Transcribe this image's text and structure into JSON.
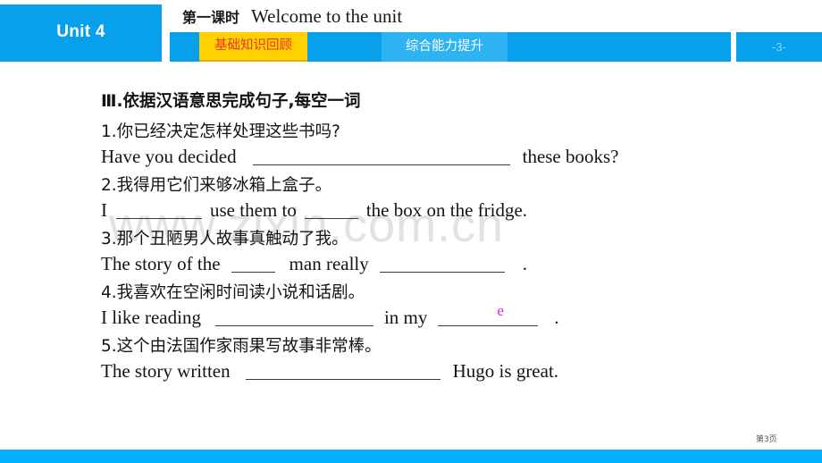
{
  "colors": {
    "brand_blue": "#08a0ea",
    "tab_active_bg": "#ffd100",
    "tab_active_text": "#e8352a",
    "tab_inactive_bg": "#2eb3f2",
    "footer_bar": "#00b0ff",
    "pink_accent": "#f50ff5",
    "watermark": "#e2e2e6"
  },
  "header": {
    "unit_label": "Unit 4",
    "lesson_cn": "第一课时",
    "lesson_en": "Welcome to the unit",
    "tabs": [
      {
        "label": "基础知识回顾",
        "active": true
      },
      {
        "label": "综合能力提升",
        "active": false
      }
    ],
    "page_chip": "-3-"
  },
  "watermark": "www.zixin.com.cn",
  "exercise": {
    "heading": "Ⅲ.依据汉语意思完成句子,每空一词",
    "items": [
      {
        "number": "1.",
        "cn": "1.你已经决定怎样处理这些书吗?",
        "en_before": "Have you decided",
        "en_after": "these books?"
      },
      {
        "number": "2.",
        "cn": "2.我得用它们来够冰箱上盒子。",
        "en_before": "I",
        "en_middle": "use them to",
        "en_after": "the box on the fridge."
      },
      {
        "number": "3.",
        "cn": "3.那个丑陋男人故事真触动了我。",
        "en_before": "The story of the",
        "en_middle": "man really",
        "en_after": "."
      },
      {
        "number": "4.",
        "cn": "4.我喜欢在空闲时间读小说和话剧。",
        "en_before": "I like reading",
        "en_middle": "in my",
        "en_after": ".",
        "annotation": "e"
      },
      {
        "number": "5.",
        "cn": "5.这个由法国作家雨果写故事非常棒。",
        "en_before": "The story written",
        "en_after": "Hugo is great."
      }
    ]
  },
  "footer": {
    "page_label": "第3页"
  }
}
